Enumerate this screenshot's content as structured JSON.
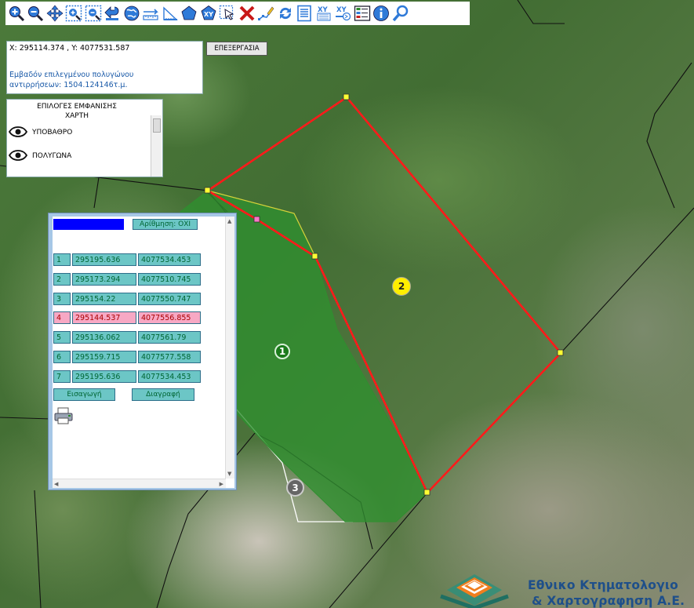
{
  "toolbar": {
    "tools": [
      "zoom-in-icon",
      "zoom-out-icon",
      "pan-icon",
      "zoom-box-in-icon",
      "zoom-box-out-icon",
      "previous-view-icon",
      "full-extent-icon",
      "measure-distance-icon",
      "measure-area-icon",
      "draw-polygon-icon",
      "go-to-xy-icon",
      "select-icon",
      "delete-icon",
      "edit-vertices-icon",
      "refresh-icon",
      "list-icon",
      "import-xy-icon",
      "export-xy-icon",
      "legend-icon",
      "info-icon",
      "search-icon"
    ]
  },
  "coords_panel": {
    "coords": "X: 295114.374 , Y: 4077531.587",
    "area_line1": "Εμβαδόν επιλεγμένου πολυγώνου",
    "area_line2": "αντιρρήσεων: 1504.124146τ.μ."
  },
  "edit_button": "ΕΠΕΞΕΡΓΑΣΙΑ",
  "layers": {
    "title_line1": "ΕΠΙΛΟΓΕΣ ΕΜΦΑΝΙΣΗΣ",
    "title_line2": "ΧΑΡΤΗ",
    "items": [
      {
        "label": "ΥΠΟΒΑΘΡΟ"
      },
      {
        "label": "ΠΟΛΥΓΩΝΑ"
      }
    ]
  },
  "dialog": {
    "color": "#0000ff",
    "numbering": "Αρίθμηση: ΟΧΙ",
    "vertices": [
      {
        "n": "1",
        "x": "295195.636",
        "y": "4077534.453",
        "selected": false
      },
      {
        "n": "2",
        "x": "295173.294",
        "y": "4077510.745",
        "selected": false
      },
      {
        "n": "3",
        "x": "295154.22",
        "y": "4077550.747",
        "selected": false
      },
      {
        "n": "4",
        "x": "295144.537",
        "y": "4077556.855",
        "selected": true
      },
      {
        "n": "5",
        "x": "295136.062",
        "y": "4077561.79",
        "selected": false
      },
      {
        "n": "6",
        "x": "295159.715",
        "y": "4077577.558",
        "selected": false
      },
      {
        "n": "7",
        "x": "295195.636",
        "y": "4077534.453",
        "selected": false
      }
    ],
    "insert_button": "Εισαγωγή",
    "delete_button": "Διαγραφή"
  },
  "map": {
    "polygon_labels": [
      "1",
      "2",
      "3"
    ],
    "polygon_label_colors": [
      "#1b7a1b",
      "#ffee00",
      "#666666"
    ],
    "objection_line_color": "#ff1a1a",
    "parcel_fill_color": "#2f8f2f"
  },
  "logo": {
    "line1": "Εθνικο Κτηματολογιο",
    "line2": "& Χαρτογραφηση Α.Ε."
  }
}
